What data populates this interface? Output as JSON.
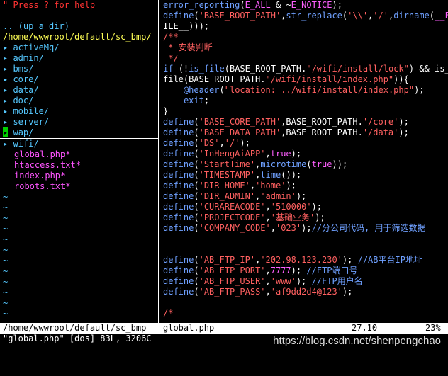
{
  "explorer": {
    "help": "\" Press ? for help",
    "up": ".. (up a dir)",
    "cwd": "/home/wwwroot/default/sc_bmp/",
    "dirs": [
      "activeMq/",
      "admin/",
      "bms/",
      "core/",
      "data/",
      "doc/",
      "mobile/",
      "server/",
      "wap/",
      "wifi/"
    ],
    "files": [
      "global.php*",
      "htaccess.txt*",
      "index.php*",
      "robots.txt*"
    ],
    "tilde": "~"
  },
  "code": [
    {
      "t": "error_reporting(E_ALL & ~E_NOTICE);"
    },
    {
      "t": "define('BASE_ROOT_PATH',str_replace('\\\\','/',dirname(__F"
    },
    {
      "t": "ILE__)));"
    },
    {
      "t": "/**"
    },
    {
      "t": " * 安装判断"
    },
    {
      "t": " */"
    },
    {
      "t": "if (!is_file(BASE_ROOT_PATH.\"/wifi/install/lock\") && is_"
    },
    {
      "t": "file(BASE_ROOT_PATH.\"/wifi/install/index.php\")){"
    },
    {
      "t": "    @header(\"location: ../wifi/install/index.php\");"
    },
    {
      "t": "    exit;"
    },
    {
      "t": "}"
    },
    {
      "t": "define('BASE_CORE_PATH',BASE_ROOT_PATH.'/core');"
    },
    {
      "t": "define('BASE_DATA_PATH',BASE_ROOT_PATH.'/data');"
    },
    {
      "t": "define('DS','/');"
    },
    {
      "t": "define('InHengAiAPP',true);"
    },
    {
      "t": "define('StartTime',microtime(true));"
    },
    {
      "t": "define('TIMESTAMP',time());"
    },
    {
      "t": "define('DIR_HOME','home');"
    },
    {
      "t": "define('DIR_ADMIN','admin');"
    },
    {
      "t": "define('CURAREACODE','510000');"
    },
    {
      "t": "define('PROJECTCODE','基础业务');"
    },
    {
      "t": "define('COMPANY_CODE','023');//分公司代码, 用于筛选数据"
    },
    {
      "t": ""
    },
    {
      "t": ""
    },
    {
      "t": "define('AB_FTP_IP','202.98.123.230'); //AB平台IP地址"
    },
    {
      "t": "define('AB_FTP_PORT',7777); //FTP端口号"
    },
    {
      "t": "define('AB_FTP_USER','www'); //FTP用户名"
    },
    {
      "t": "define('AB_FTP_PASS','af9dd2d4@123');"
    },
    {
      "t": ""
    },
    {
      "t": "/*"
    }
  ],
  "status": {
    "left": "/home/wwwroot/default/sc_bmp",
    "file": "global.php",
    "pos": "27,10",
    "pct": "23%"
  },
  "cmdline": "\"global.php\" [dos] 83L, 3206C",
  "watermark": "https://blog.csdn.net/shenpengchao"
}
